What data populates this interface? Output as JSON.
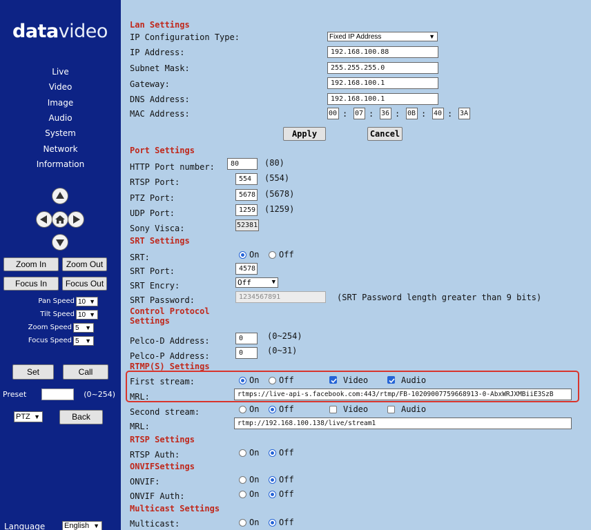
{
  "brand": {
    "logo_bold": "data",
    "logo_light": "video"
  },
  "nav": [
    "Live",
    "Video",
    "Image",
    "Audio",
    "System",
    "Network",
    "Information"
  ],
  "ptz": {
    "zoom_in": "Zoom In",
    "zoom_out": "Zoom Out",
    "focus_in": "Focus In",
    "focus_out": "Focus Out",
    "speeds": [
      {
        "label": "Pan Speed",
        "value": "10"
      },
      {
        "label": "Tilt Speed",
        "value": "10"
      },
      {
        "label": "Zoom Speed",
        "value": "5"
      },
      {
        "label": "Focus Speed",
        "value": "5"
      }
    ],
    "set": "Set",
    "call": "Call",
    "preset_label": "Preset",
    "preset_value": "",
    "preset_range": "(0~254)",
    "mode": "PTZ",
    "back": "Back"
  },
  "language": {
    "label": "Language",
    "value": "English"
  },
  "lan": {
    "title": "Lan Settings",
    "ip_type_label": "IP Configuration Type:",
    "ip_type_value": "Fixed IP Address",
    "ip_label": "IP Address:",
    "ip_value": "192.168.100.88",
    "mask_label": "Subnet Mask:",
    "mask_value": "255.255.255.0",
    "gw_label": "Gateway:",
    "gw_value": "192.168.100.1",
    "dns_label": "DNS Address:",
    "dns_value": "192.168.100.1",
    "mac_label": "MAC Address:",
    "mac": [
      "00",
      "07",
      "36",
      "0B",
      "40",
      "3A"
    ],
    "apply": "Apply",
    "cancel": "Cancel"
  },
  "port": {
    "title": "Port Settings",
    "http_label": "HTTP Port number:",
    "http_value": "80",
    "http_default": "(80)",
    "rtsp_label": "RTSP Port:",
    "rtsp_value": "554",
    "rtsp_default": "(554)",
    "ptz_label": "PTZ Port:",
    "ptz_value": "5678",
    "ptz_default": "(5678)",
    "udp_label": "UDP Port:",
    "udp_value": "1259",
    "udp_default": "(1259)",
    "visca_label": "Sony Visca:",
    "visca_value": "52381"
  },
  "srt": {
    "title": "SRT Settings",
    "srt_label": "SRT:",
    "on": "On",
    "off": "Off",
    "port_label": "SRT Port:",
    "port_value": "4578",
    "encry_label": "SRT Encry:",
    "encry_value": "Off",
    "pwd_label": "SRT Password:",
    "pwd_value": "1234567891",
    "pwd_note": "(SRT Password length greater than 9 bits)"
  },
  "control": {
    "title_line1": "Control Protocol",
    "title_line2": "Settings",
    "pelco_d_label": "Pelco-D Address:",
    "pelco_d_value": "0",
    "pelco_d_range": "(0~254)",
    "pelco_p_label": "Pelco-P Address:",
    "pelco_p_value": "0",
    "pelco_p_range": "(0~31)"
  },
  "rtmp": {
    "title": "RTMP(S) Settings",
    "first_label": "First stream:",
    "on": "On",
    "off": "Off",
    "video": "Video",
    "audio": "Audio",
    "mrl_label": "MRL:",
    "first_mrl": "rtmps://live-api-s.facebook.com:443/rtmp/FB-10209007759668913-0-AbxWRJXMBiiE3SzB",
    "second_label": "Second stream:",
    "second_mrl": "rtmp://192.168.100.138/live/stream1"
  },
  "rtsp": {
    "title": "RTSP Settings",
    "auth_label": "RTSP Auth:",
    "on": "On",
    "off": "Off"
  },
  "onvif": {
    "title": "ONVIFSettings",
    "onvif_label": "ONVIF:",
    "auth_label": "ONVIF Auth:",
    "on": "On",
    "off": "Off"
  },
  "multicast": {
    "title": "Multicast Settings",
    "label": "Multicast:",
    "on": "On",
    "off": "Off"
  }
}
